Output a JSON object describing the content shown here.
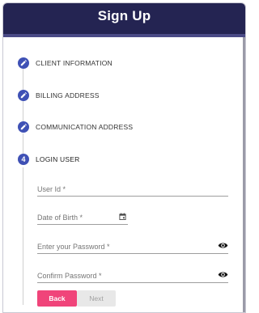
{
  "header": {
    "title": "Sign Up"
  },
  "steps": [
    {
      "marker": "",
      "icon": "pencil-icon",
      "label": "CLIENT INFORMATION"
    },
    {
      "marker": "",
      "icon": "pencil-icon",
      "label": "BILLING ADDRESS"
    },
    {
      "marker": "",
      "icon": "pencil-icon",
      "label": "COMMUNICATION ADDRESS"
    },
    {
      "marker": "4",
      "icon": "",
      "label": "LOGIN USER"
    }
  ],
  "form": {
    "user_id": {
      "placeholder": "User Id *",
      "value": ""
    },
    "dob": {
      "placeholder": "Date of Birth *",
      "value": "",
      "icon": "calendar-icon"
    },
    "password": {
      "placeholder": "Enter your Password *",
      "value": "",
      "icon": "eye-icon"
    },
    "confirm_password": {
      "placeholder": "Confirm Password *",
      "value": "",
      "icon": "eye-icon"
    }
  },
  "buttons": {
    "back": "Back",
    "next": "Next"
  },
  "colors": {
    "header": "#242452",
    "accent": "#3f51b5",
    "back_button": "#f0447a"
  }
}
